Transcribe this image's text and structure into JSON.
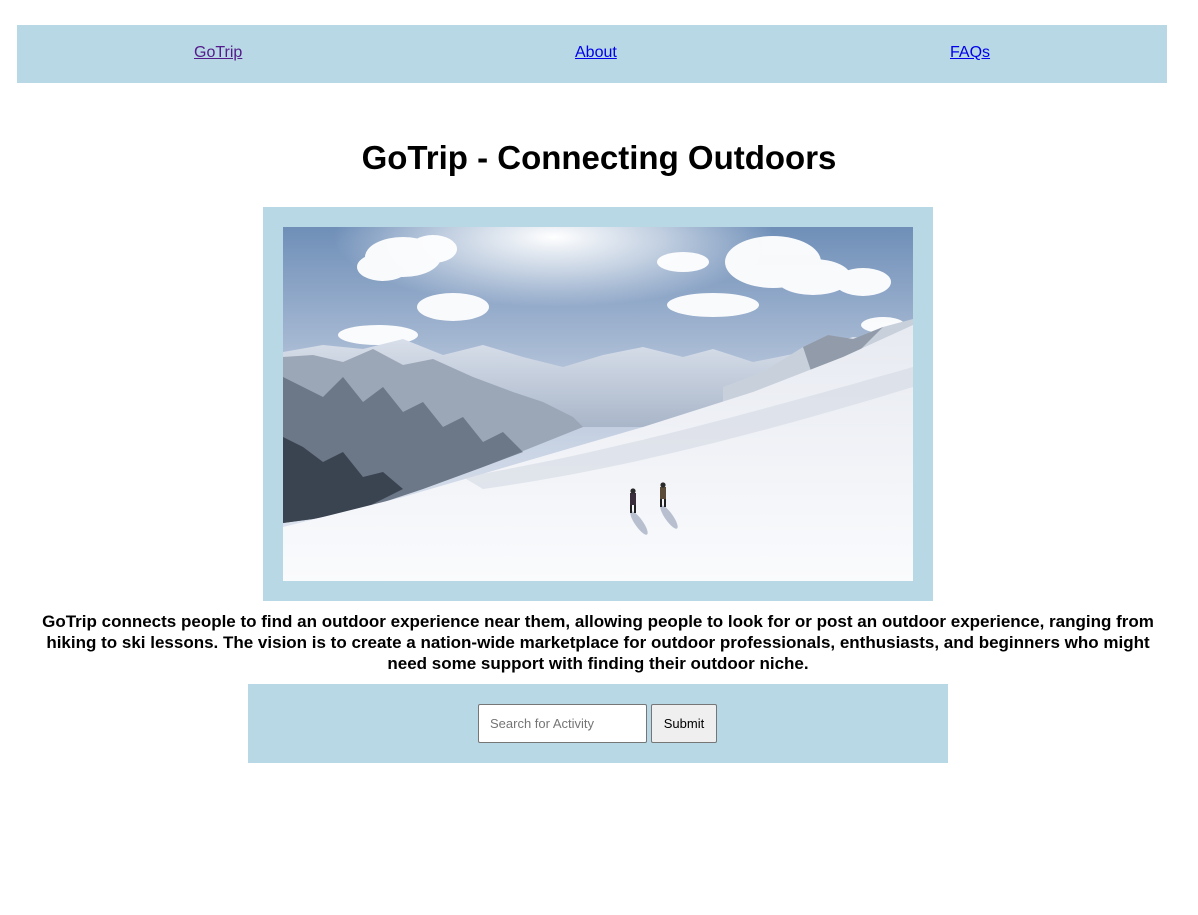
{
  "nav": {
    "items": [
      {
        "label": "GoTrip"
      },
      {
        "label": "About"
      },
      {
        "label": "FAQs"
      }
    ]
  },
  "main": {
    "title": "GoTrip - Connecting Outdoors",
    "hero_image": {
      "icon": "snowy-mountain-skiers-photo",
      "colors": {
        "frame": "#b7d8e4",
        "sky": "#7f9cc0",
        "snow": "#f2f3f7"
      }
    },
    "description": "GoTrip connects people to find an outdoor experience near them, allowing people to look for or post an outdoor experience, ranging from hiking to ski lessons. The vision is to create a nation-wide marketplace for outdoor professionals, enthusiasts, and beginners who might need some support with finding their outdoor niche."
  },
  "search": {
    "placeholder": "Search for Activity",
    "value": "",
    "submit_label": "Submit"
  },
  "colors": {
    "panel_background": "#b7d8e4",
    "visited_link": "#551a8b",
    "link": "#0000ee"
  }
}
